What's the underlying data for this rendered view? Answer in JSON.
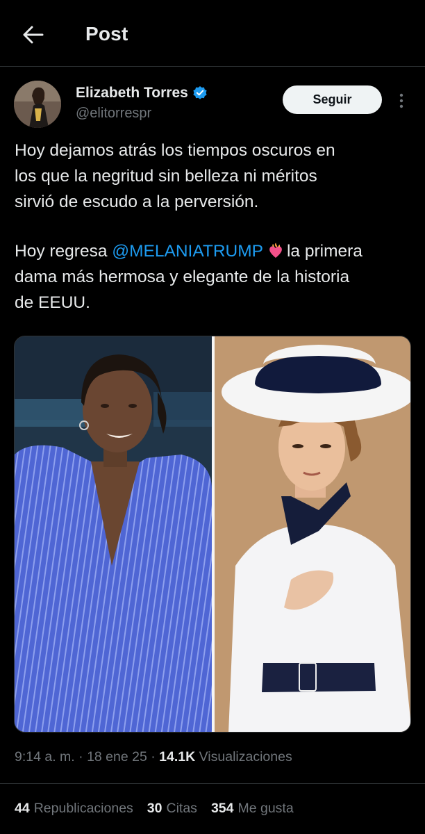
{
  "header": {
    "title": "Post",
    "back_icon": "arrow-left-icon"
  },
  "author": {
    "display_name": "Elizabeth Torres",
    "handle": "@elitorrespr",
    "verified_icon": "verified-badge-icon",
    "verified_color": "#1d9bf0",
    "follow_label": "Seguir",
    "more_icon": "more-vertical-icon"
  },
  "tweet": {
    "lines_p1": [
      "Hoy dejamos atrás los tiempos oscuros en",
      "los que la negritud sin belleza ni méritos",
      "sirvió de escudo a la perversión."
    ],
    "p2_prefix": "Hoy regresa ",
    "mention": "@MELANIATRUMP",
    "emoji": "heart-on-fire-icon",
    "p2_line1_suffix": "la primera",
    "p2_lines_rest": [
      "dama más hermosa y elegante de la historia",
      "de EEUU."
    ]
  },
  "meta": {
    "time": "9:14 a. m.",
    "separator": "·",
    "date": "18 ene 25",
    "views_count": "14.1K",
    "views_label": "Visualizaciones"
  },
  "stats": [
    {
      "count": "44",
      "label": "Republicaciones"
    },
    {
      "count": "30",
      "label": "Citas"
    },
    {
      "count": "354",
      "label": "Me gusta"
    }
  ],
  "colors": {
    "background": "#000000",
    "text": "#e7e9ea",
    "muted": "#71767b",
    "accent": "#1d9bf0",
    "divider": "#2f3336"
  }
}
